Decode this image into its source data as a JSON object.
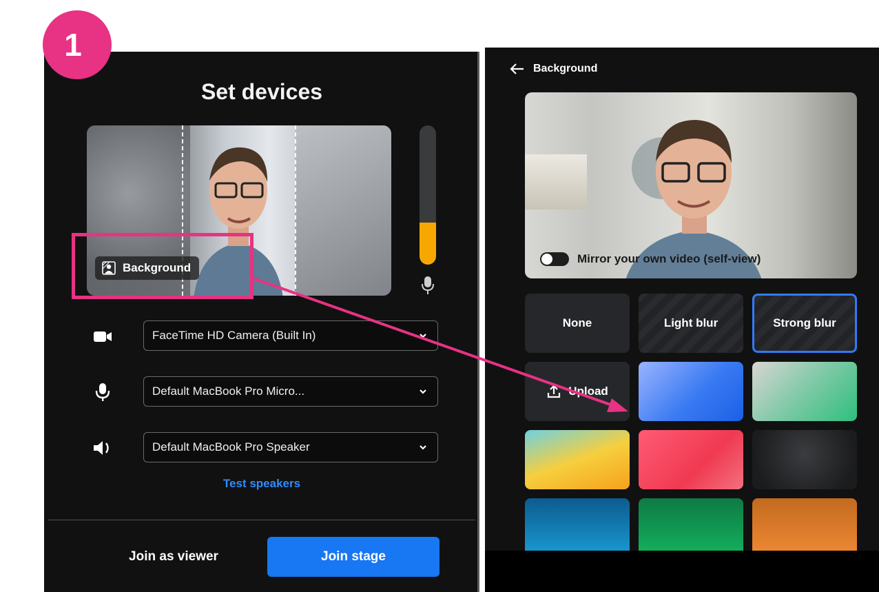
{
  "step_badge": "1",
  "left_panel": {
    "title": "Set devices",
    "background_chip": "Background",
    "mic_level_fraction": 0.3,
    "devices": {
      "camera": "FaceTime HD Camera (Built In)",
      "microphone": "Default MacBook Pro Micro...",
      "speaker": "Default MacBook Pro Speaker"
    },
    "test_speakers": "Test speakers",
    "join_viewer": "Join as viewer",
    "join_stage": "Join stage"
  },
  "right_panel": {
    "header": "Background",
    "mirror_label": "Mirror your own video (self-view)",
    "mirror_on": false,
    "tiles": [
      "None",
      "Light blur",
      "Strong blur",
      "Upload"
    ],
    "selected_tile": "Strong blur"
  },
  "colors": {
    "accent_pink": "#e83283",
    "primary_blue": "#1877f2",
    "link_blue": "#2f8cff",
    "meter_orange": "#f7a800"
  }
}
